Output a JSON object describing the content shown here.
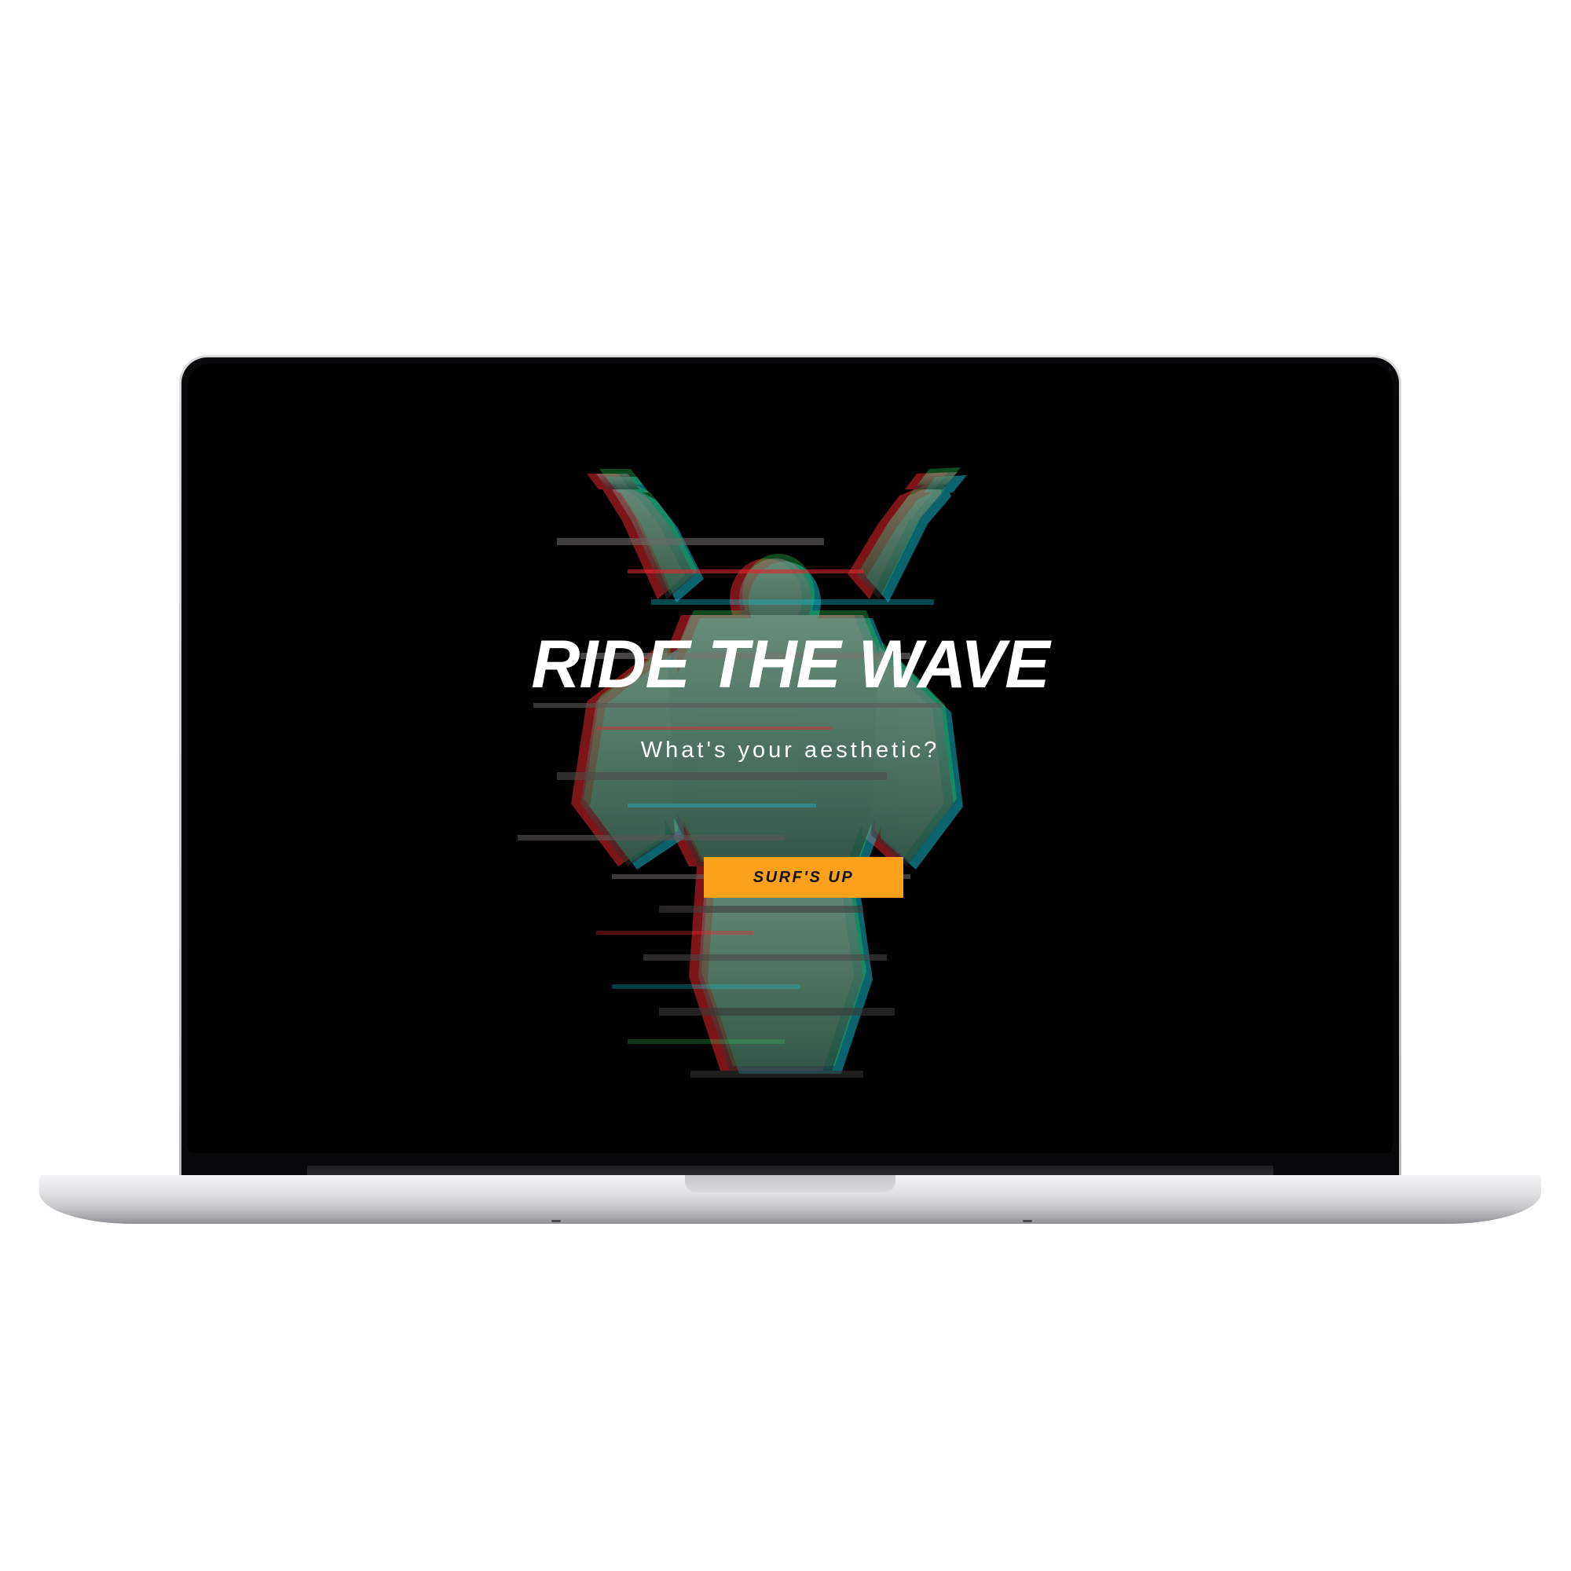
{
  "hero": {
    "title": "RIDE THE WAVE",
    "subtitle": "What's your aesthetic?",
    "cta_label": "SURF'S UP"
  },
  "colors": {
    "screen_background": "#000000",
    "title_text": "#ffffff",
    "cta_background": "#f9a11b",
    "cta_text": "#111111",
    "glitch_red": "#e2262e",
    "glitch_cyan": "#16c6d8",
    "glitch_green": "#2fd05a"
  },
  "art": {
    "subject": "glitched angel statue with raised arms"
  }
}
